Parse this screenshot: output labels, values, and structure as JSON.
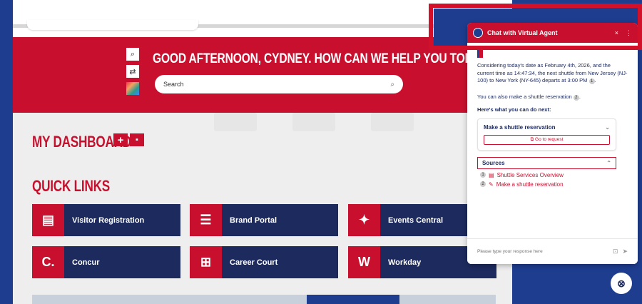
{
  "hero": {
    "greeting": "GOOD AFTERNOON, CYDNEY. HOW CAN WE HELP YOU TODAY?",
    "search_label": "Search"
  },
  "dashboard": {
    "title": "MY DASHBOARD"
  },
  "quick_links": {
    "title": "QUICK LINKS",
    "tiles": [
      {
        "label": "Visitor Registration",
        "icon": "badge-icon"
      },
      {
        "label": "Brand Portal",
        "icon": "clipboard-icon"
      },
      {
        "label": "Events Central",
        "icon": "confetti-icon"
      },
      {
        "label": "Concur",
        "icon": "concur-logo-icon"
      },
      {
        "label": "Career Court",
        "icon": "court-icon"
      },
      {
        "label": "Workday",
        "icon": "workday-logo-icon"
      }
    ]
  },
  "chat": {
    "title": "Chat with Virtual Agent",
    "close": "×",
    "more": "⋮",
    "message_parts": {
      "p1": "Considering today's date as February 4th, 2026, and the current time as 14:47:34, the next shuttle from New Jersey (NJ-100) to New York (NY-645) departs at 3:00 PM",
      "p1_cite": "1",
      "p2": "You can also make a shuttle reservation",
      "p2_cite": "2"
    },
    "next_heading": "Here's what you can do next:",
    "card_title": "Make a shuttle reservation",
    "card_link": "Go to request",
    "sources_label": "Sources",
    "sources": [
      {
        "num": "1",
        "label": "Shuttle Services Overview"
      },
      {
        "num": "2",
        "label": "Make a shuttle reservation"
      }
    ],
    "input_placeholder": "Please type your response here"
  }
}
